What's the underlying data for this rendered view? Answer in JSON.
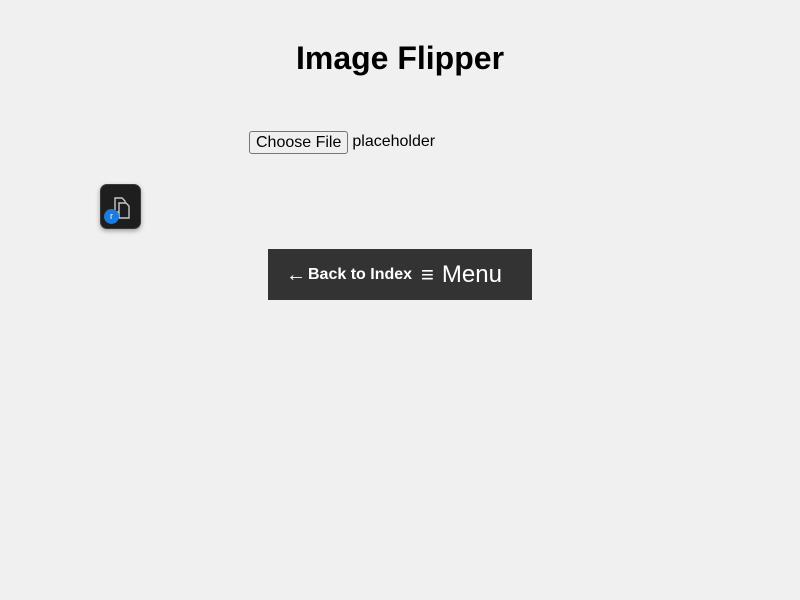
{
  "page": {
    "title": "Image Flipper"
  },
  "file_input": {
    "button_label": "Choose File",
    "file_name": "placeholder"
  },
  "app_icon": {
    "icon": "copy-pages-icon",
    "badge_text": "r"
  },
  "nav": {
    "back_arrow": "←",
    "back_label": "Back to Index",
    "menu_icon": "≡",
    "menu_label": "Menu"
  },
  "colors": {
    "background": "#f0f0f0",
    "nav_background": "#333333",
    "nav_text": "#ffffff",
    "badge": "#1a7be0"
  }
}
